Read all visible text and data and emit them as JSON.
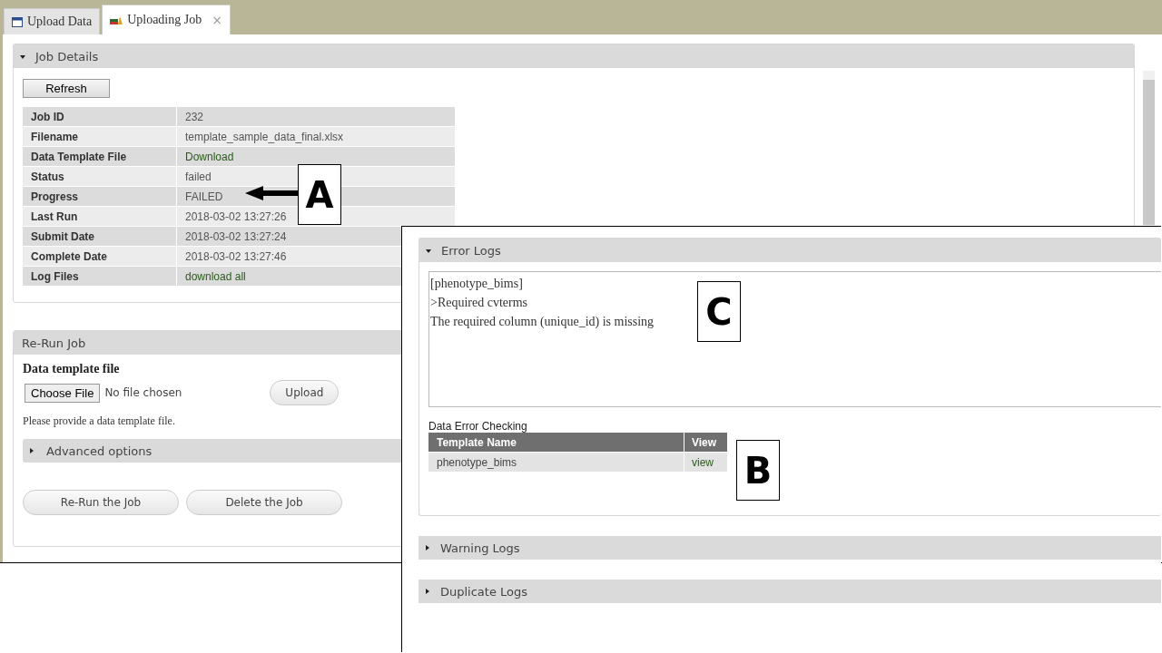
{
  "tabs": [
    {
      "label": "Upload Data",
      "selected": false
    },
    {
      "label": "Uploading Job",
      "selected": true,
      "close": "×"
    }
  ],
  "job_details": {
    "title": "Job Details",
    "expanded": true,
    "refresh": "Refresh",
    "rows": [
      {
        "label": "Job ID",
        "value": "232",
        "kind": "text"
      },
      {
        "label": "Filename",
        "value": "template_sample_data_final.xlsx",
        "kind": "text"
      },
      {
        "label": "Data Template File",
        "value": "Download",
        "kind": "link"
      },
      {
        "label": "Status",
        "value": "failed",
        "kind": "text"
      },
      {
        "label": "Progress",
        "value": "FAILED",
        "kind": "text"
      },
      {
        "label": "Last Run",
        "value": "2018-03-02 13:27:26",
        "kind": "text"
      },
      {
        "label": "Submit Date",
        "value": "2018-03-02 13:27:24",
        "kind": "text"
      },
      {
        "label": "Complete Date",
        "value": "2018-03-02 13:27:46",
        "kind": "text"
      },
      {
        "label": "Log Files",
        "value": "download all",
        "kind": "link"
      }
    ]
  },
  "rerun": {
    "title": "Re-Run Job",
    "file_label": "Data template file",
    "choose": "Choose File",
    "no_file": "No file chosen",
    "upload": "Upload",
    "hint": "Please provide a data template file.",
    "advanced": {
      "title": "Advanced options",
      "expanded": false
    },
    "buttons": [
      "Re-Run the Job",
      "Delete the Job"
    ]
  },
  "inset": {
    "sections": [
      {
        "title": "Error Logs",
        "expanded": true,
        "log_lines": [
          "[phenotype_bims]",
          ">Required cvterms",
          "The required column (unique_id) is missing"
        ],
        "table": {
          "caption": "Data Error Checking",
          "columns": [
            "Template Name",
            "View"
          ],
          "rows": [
            [
              "phenotype_bims",
              "view"
            ]
          ]
        }
      },
      {
        "title": "Warning Logs",
        "expanded": false
      },
      {
        "title": "Duplicate Logs",
        "expanded": false
      }
    ]
  },
  "annotations": [
    {
      "letter": "A",
      "arrow": true
    },
    {
      "letter": "B",
      "arrow": false
    },
    {
      "letter": "C",
      "arrow": false
    }
  ]
}
